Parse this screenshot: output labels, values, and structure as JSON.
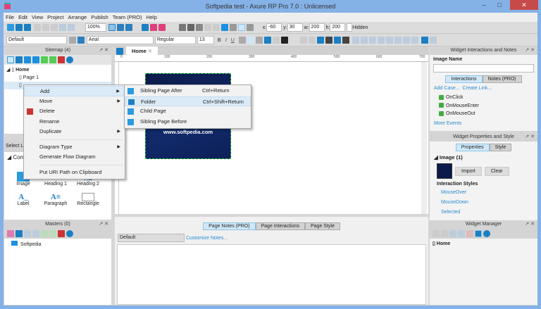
{
  "window": {
    "title": "Softpedia test - Axure RP Pro 7.0 : Unlicensed",
    "minimize": "–",
    "maximize": "□",
    "close": "✕"
  },
  "menu": [
    "File",
    "Edit",
    "View",
    "Project",
    "Arrange",
    "Publish",
    "Team (PRO)",
    "Help"
  ],
  "toolbar": {
    "zoom": "100%",
    "x_label": "x:",
    "x": "-60",
    "y_label": "y:",
    "y": "30",
    "w_label": "w:",
    "w": "200",
    "h_label": "h:",
    "h": "200",
    "hidden": "Hidden",
    "style": "Default",
    "font": "Arial",
    "weight": "Regular",
    "size": "13",
    "bold": "B",
    "italic": "I",
    "underline": "U"
  },
  "sitemap": {
    "title": "Sitemap (4)",
    "items": [
      "Home",
      "Page 1"
    ]
  },
  "context_menu": {
    "items": [
      "Add",
      "Move",
      "Delete",
      "Rename",
      "Duplicate",
      "Diagram Type",
      "Generate Flow Diagram",
      "Put URI Path on Clipboard"
    ]
  },
  "submenu": {
    "items": [
      {
        "label": "Sibling Page After",
        "shortcut": "Ctrl+Return"
      },
      {
        "label": "Folder",
        "shortcut": "Ctrl+Shift+Return"
      },
      {
        "label": "Child Page",
        "shortcut": ""
      },
      {
        "label": "Sibling Page Before",
        "shortcut": ""
      }
    ]
  },
  "widgets": {
    "select_label": "Select Li",
    "group": "Com",
    "items": [
      "Image",
      "Heading 1",
      "Heading 2",
      "Label",
      "Paragraph",
      "Rectangle"
    ]
  },
  "masters": {
    "title": "Masters (0)",
    "items": [
      "Softpedia"
    ]
  },
  "canvas": {
    "tab": "Home",
    "ruler": [
      "0",
      "100",
      "200",
      "300",
      "400",
      "500",
      "600",
      "700"
    ],
    "image_text": "www.softpedia.com"
  },
  "notes": {
    "tabs": [
      "Page Notes (PRO)",
      "Page Interactions",
      "Page Style"
    ],
    "select": "Default",
    "customize": "Customize Notes..."
  },
  "interactions": {
    "title": "Widget Interactions and Notes",
    "name_label": "Image Name",
    "name_value": "",
    "tabs": [
      "Interactions",
      "Notes (PRO)"
    ],
    "add_case": "Add Case...",
    "create_link": "Create Link...",
    "events": [
      "OnClick",
      "OnMouseEnter",
      "OnMouseOut"
    ],
    "more": "More Events"
  },
  "properties": {
    "title": "Widget Properties and Style",
    "tabs": [
      "Properties",
      "Style"
    ],
    "section": "Image (1)",
    "import": "Import",
    "clear": "Clear",
    "styles_title": "Interaction Styles",
    "styles": [
      "MouseOver",
      "MouseDown",
      "Selected"
    ]
  },
  "widget_manager": {
    "title": "Widget Manager",
    "items": [
      "Home"
    ]
  },
  "colors": {
    "accent": "#2a8bd0",
    "frame": "#84b1e6",
    "close": "#c74a4a"
  }
}
